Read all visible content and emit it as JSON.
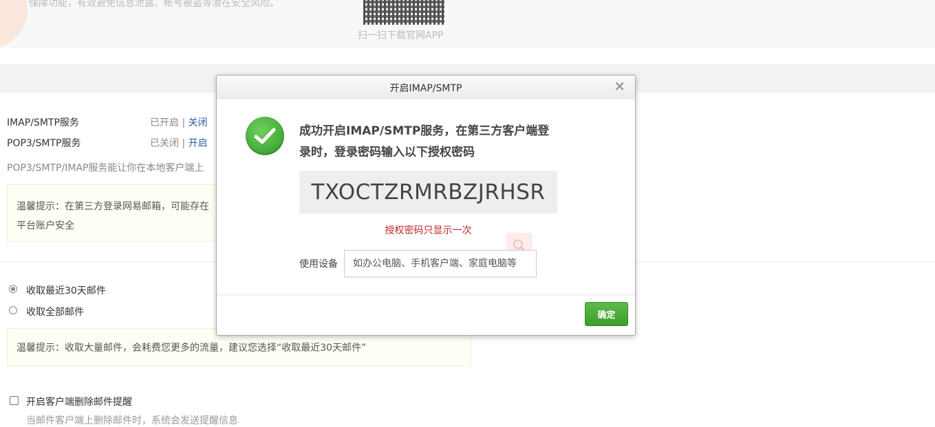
{
  "banner": {
    "text": "保障功能，有效避免信息泄露、帐号被盗等潜在安全风险。",
    "qr_caption": "扫一扫下载官网APP"
  },
  "services": {
    "imap": {
      "label": "IMAP/SMTP服务",
      "status": "已开启",
      "action": "关闭"
    },
    "pop3": {
      "label": "POP3/SMTP服务",
      "status": "已关闭",
      "action": "开启"
    },
    "separator": " | ",
    "description": "POP3/SMTP/IMAP服务能让你在本地客户端上",
    "tip": "温馨提示：在第三方登录网易邮箱，可能存在平台账户安全"
  },
  "receive": {
    "option_recent": "收取最近30天邮件",
    "option_all": "收取全部邮件",
    "tip": "温馨提示：收取大量邮件，会耗费您更多的流量，建议您选择“收取最近30天邮件”"
  },
  "delete_reminder": {
    "label": "开启客户端删除邮件提醒",
    "sub_text": "当邮件客户端上删除邮件时，系统会发送提醒信息"
  },
  "dialog": {
    "title": "开启IMAP/SMTP",
    "close": "×",
    "message": "成功开启IMAP/SMTP服务，在第三方客户端登录时，登录密码输入以下授权密码",
    "auth_code": "TXOCTZRMRBZJRHSR",
    "auth_note": "授权密码只显示一次",
    "device_label": "使用设备",
    "device_placeholder": "如办公电脑、手机客户端、家庭电脑等",
    "confirm": "确定"
  },
  "colors": {
    "link": "#2b5ea3",
    "success_green": "#3f9d2f",
    "warning_red": "#c0252b"
  }
}
